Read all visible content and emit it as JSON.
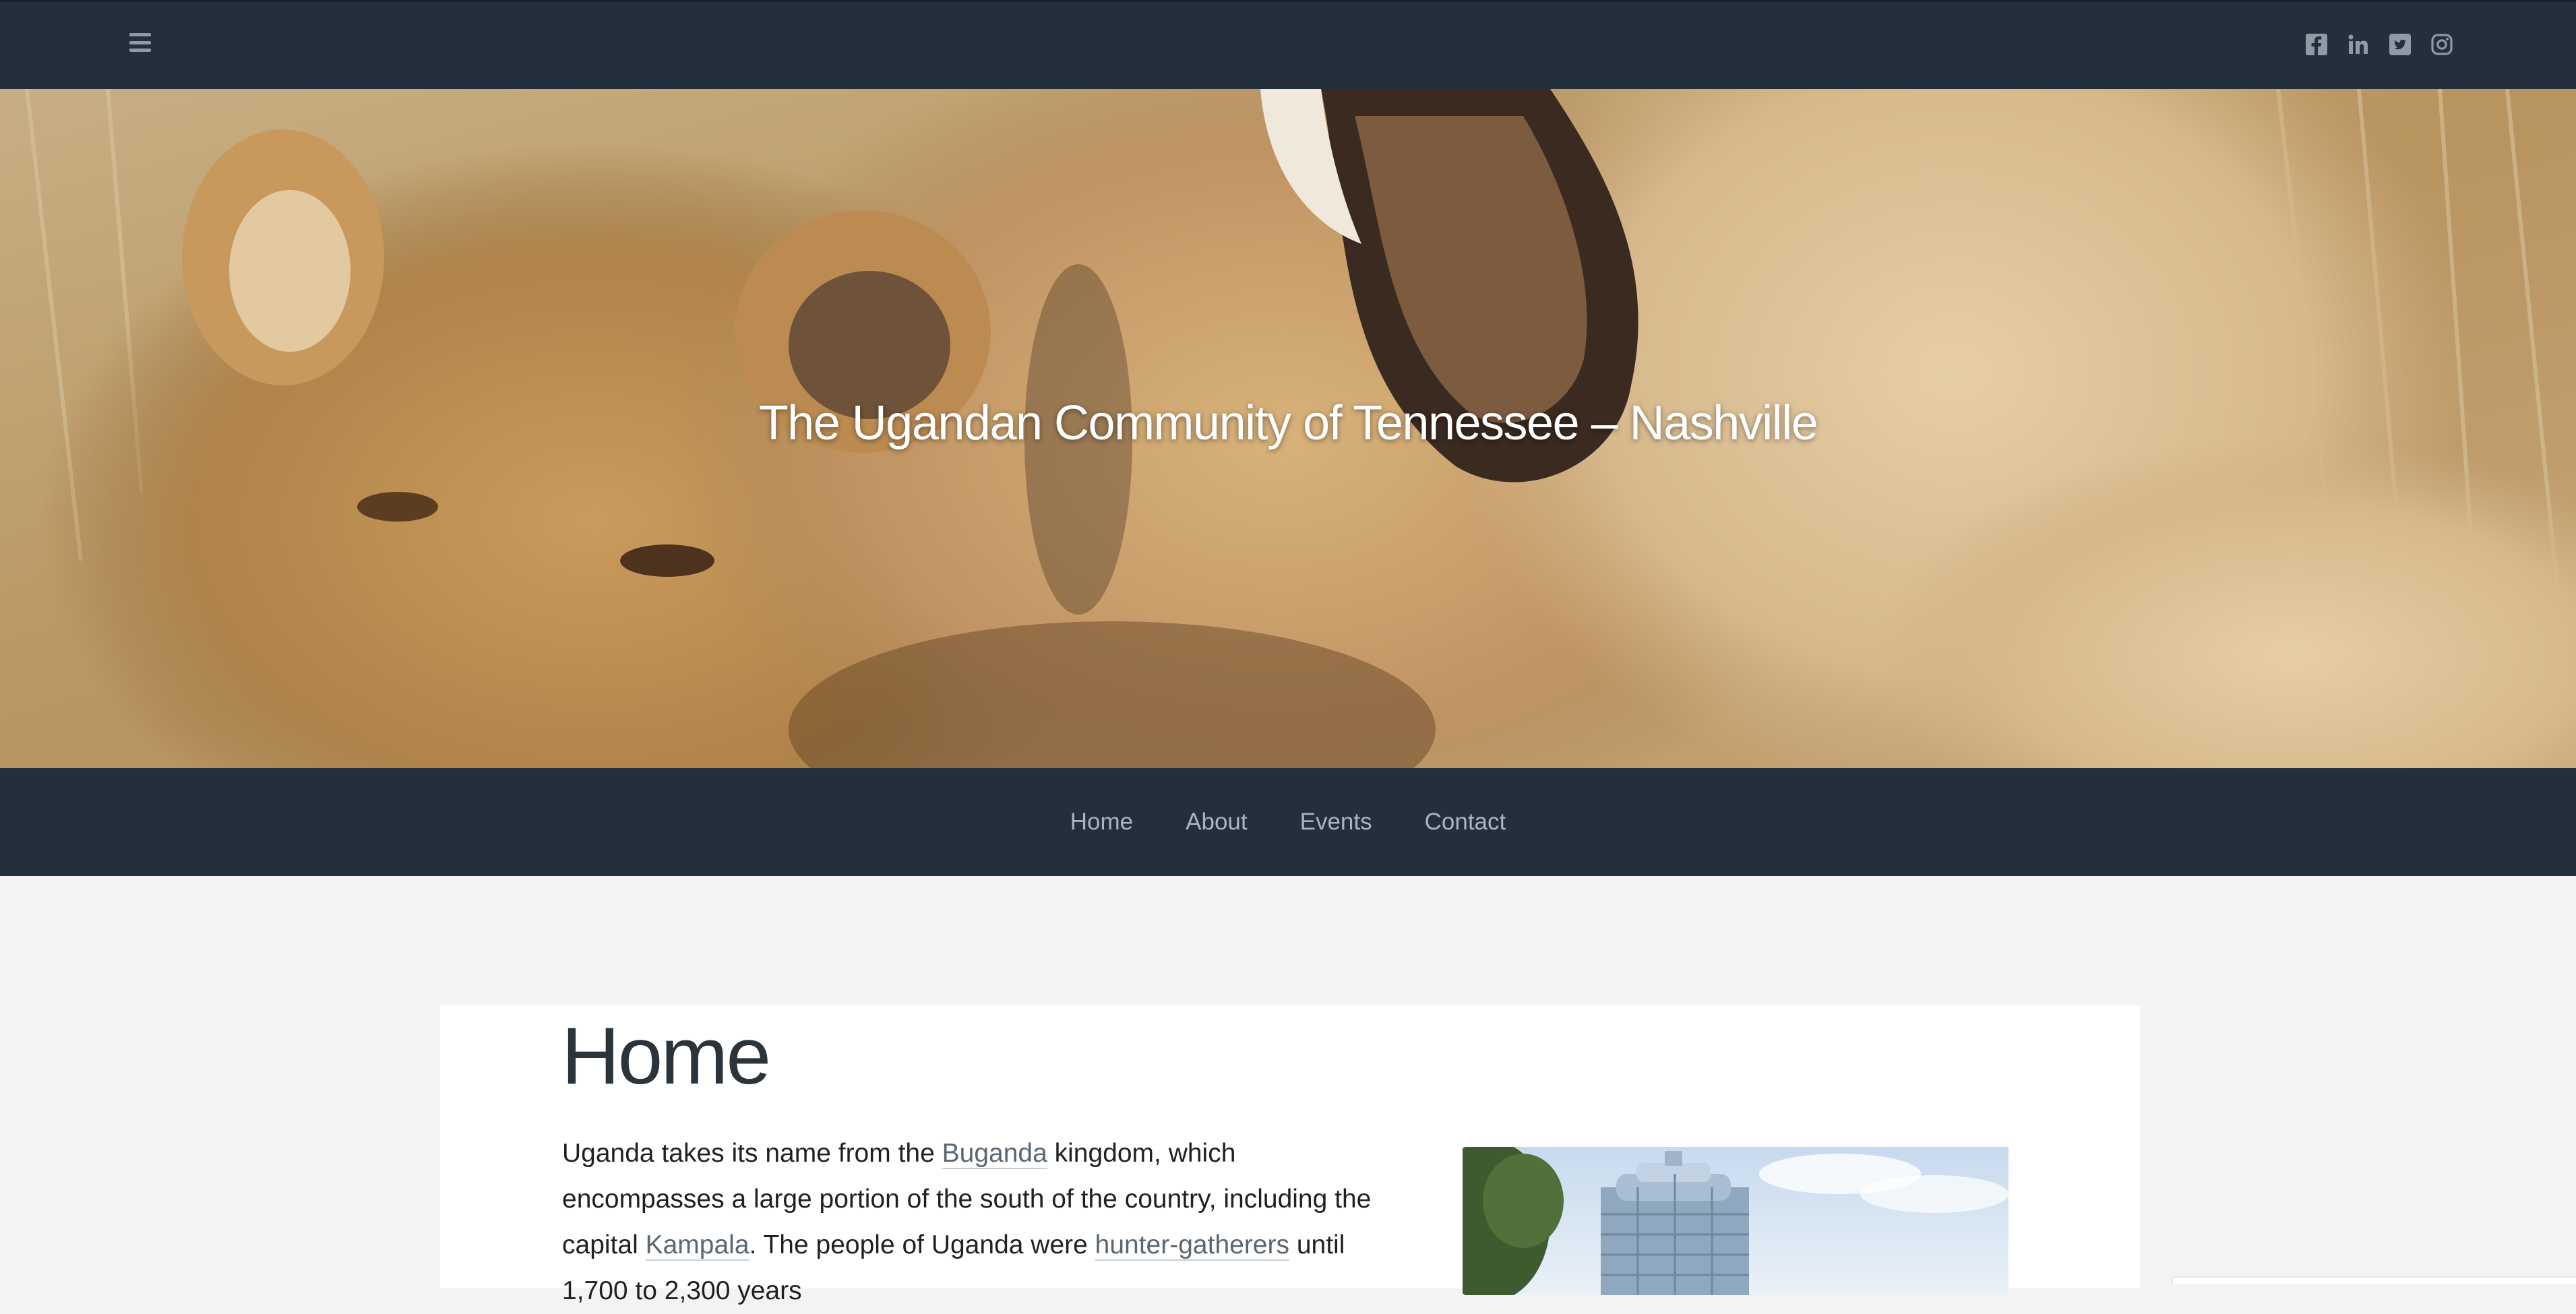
{
  "header": {
    "menu_icon": "hamburger-menu-icon",
    "social": [
      {
        "name": "facebook",
        "icon": "facebook-square-icon"
      },
      {
        "name": "linkedin",
        "icon": "linkedin-icon"
      },
      {
        "name": "twitter",
        "icon": "twitter-square-icon"
      },
      {
        "name": "instagram",
        "icon": "instagram-icon"
      }
    ],
    "icon_color": "#8f9aa5",
    "bar_color": "#232f3a"
  },
  "hero": {
    "site_title": "The Ugandan Community of Tennessee – Nashville",
    "image_subject": "lions-in-grass"
  },
  "nav": {
    "items": [
      "Home",
      "About",
      "Events",
      "Contact"
    ]
  },
  "page": {
    "title": "Home",
    "intro": {
      "t1": "Uganda takes its name from the ",
      "link1": "Buganda",
      "t2": " kingdom, which encompasses a large portion of the south of the country, including the capital ",
      "link2": "Kampala",
      "t3": ". The people of Uganda were ",
      "link3": "hunter-gatherers",
      "t4": " until 1,700 to 2,300 years"
    },
    "photo_subject": "kampala-tower-building"
  }
}
